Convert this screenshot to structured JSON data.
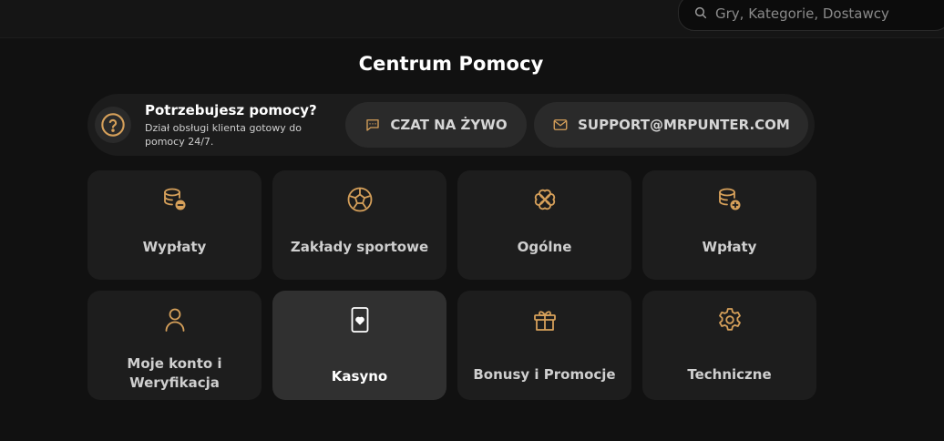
{
  "search": {
    "placeholder": "Gry, Kategorie, Dostawcy"
  },
  "page": {
    "title": "Centrum Pomocy"
  },
  "help": {
    "title": "Potrzebujesz pomocy?",
    "subtitle": "Dział obsługi klienta gotowy do pomocy 24/7.",
    "chat_label": "CZAT NA ŻYWO",
    "email_label": "SUPPORT@MRPUNTER.COM"
  },
  "colors": {
    "accent": "#d6a05a",
    "background": "#111111",
    "tile": "#1d1d1d",
    "tile_active": "#303030"
  },
  "categories": [
    {
      "label": "Wypłaty",
      "icon": "coins-minus-icon"
    },
    {
      "label": "Zakłady sportowe",
      "icon": "football-icon"
    },
    {
      "label": "Ogólne",
      "icon": "clover-icon"
    },
    {
      "label": "Wpłaty",
      "icon": "coins-plus-icon"
    },
    {
      "label": "Moje konto i Weryfikacja",
      "icon": "user-icon"
    },
    {
      "label": "Kasyno",
      "icon": "playing-card-icon",
      "active": true
    },
    {
      "label": "Bonusy i Promocje",
      "icon": "gift-icon"
    },
    {
      "label": "Techniczne",
      "icon": "gear-icon"
    }
  ]
}
